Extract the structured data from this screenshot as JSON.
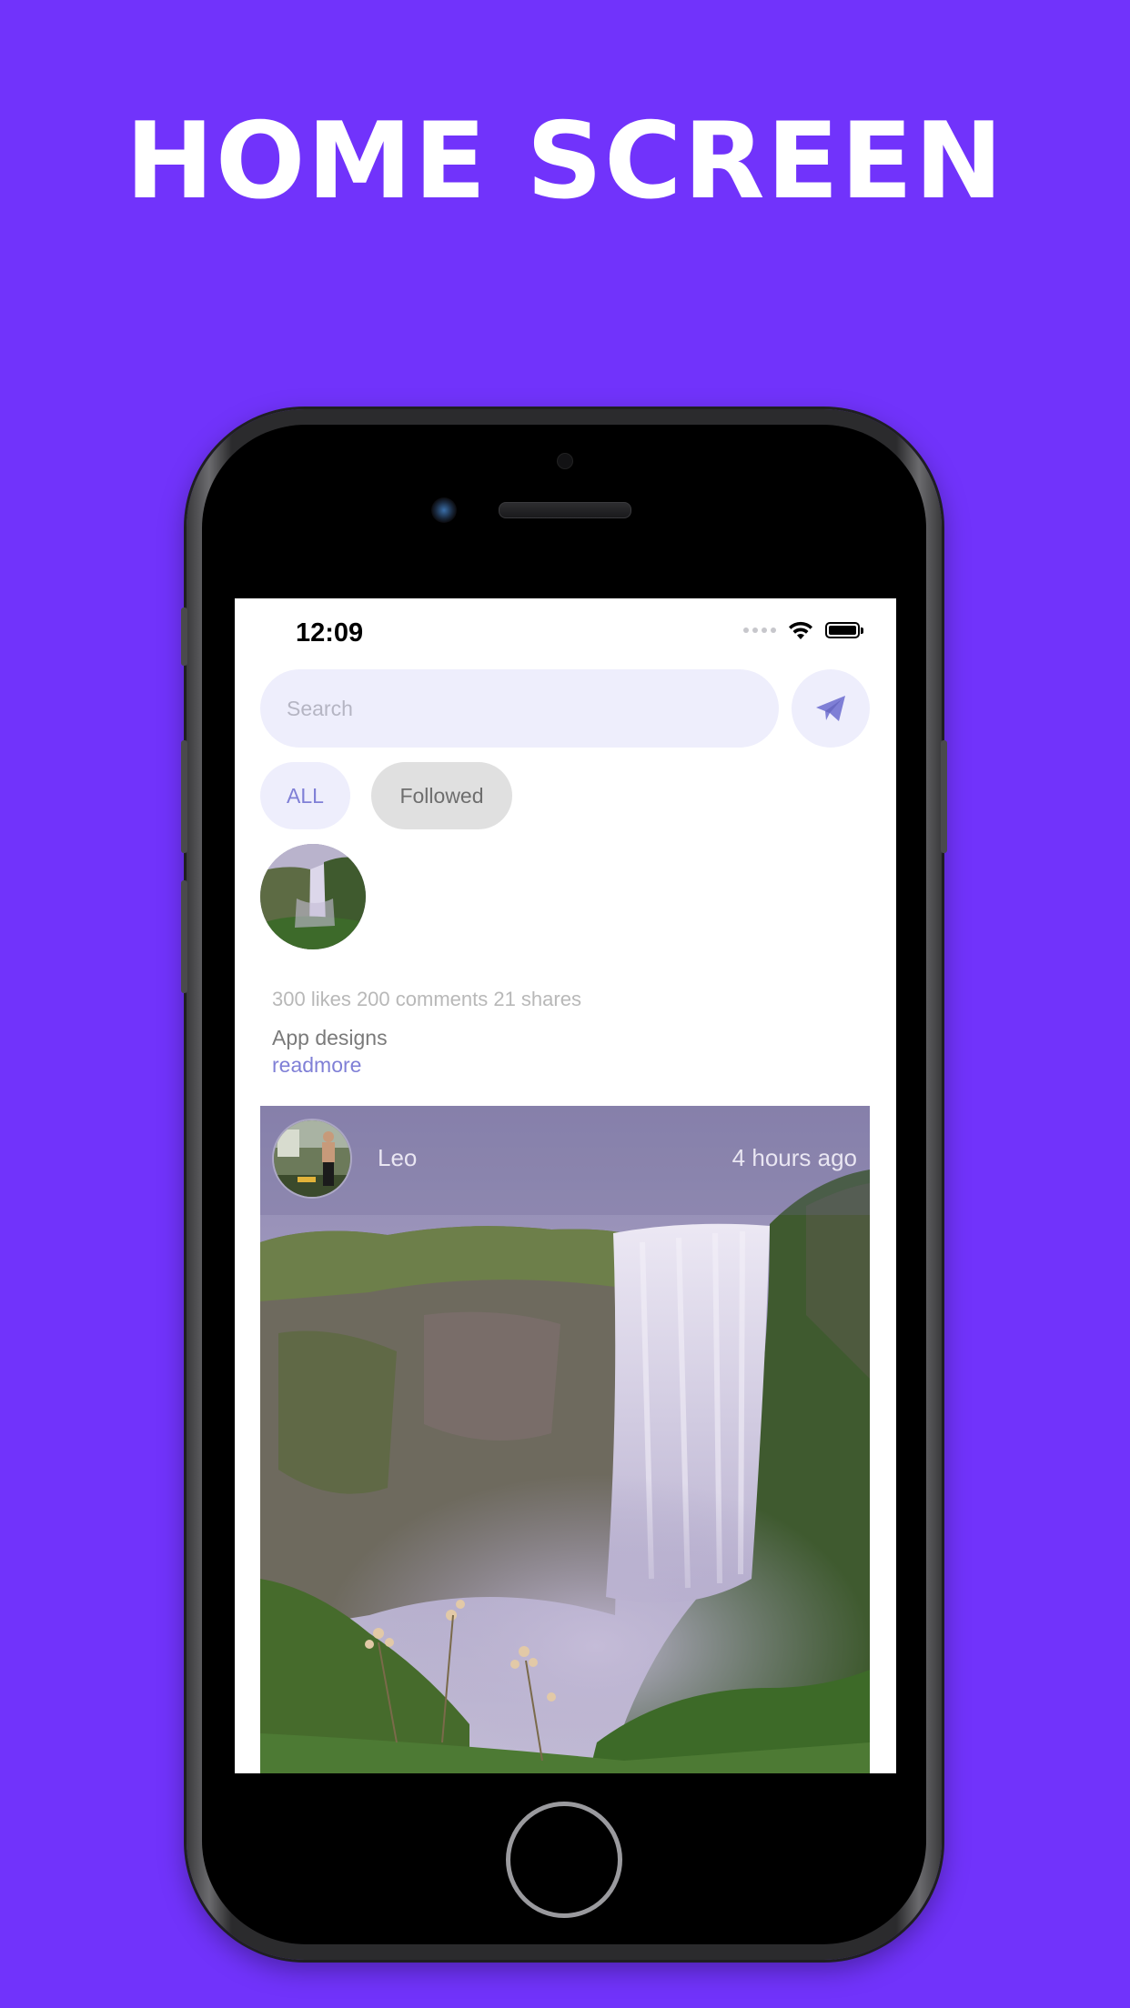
{
  "headline": "HOME SCREEN",
  "status_bar": {
    "time": "12:09"
  },
  "search": {
    "placeholder": "Search"
  },
  "filters": [
    {
      "label": "ALL"
    },
    {
      "label": "Followed"
    }
  ],
  "feed_summary": {
    "stats": "300 likes 200 comments 21 shares",
    "caption": "App designs",
    "readmore": "readmore"
  },
  "post": {
    "user": "Leo",
    "time": "4 hours ago"
  },
  "colors": {
    "background": "#7133fb",
    "accent": "#7f7fd6",
    "chip_bg": "#eeeefc",
    "chip_inactive": "#e0e0e0"
  },
  "icons": [
    "send-icon",
    "wifi-icon",
    "battery-icon",
    "signal-icon"
  ]
}
